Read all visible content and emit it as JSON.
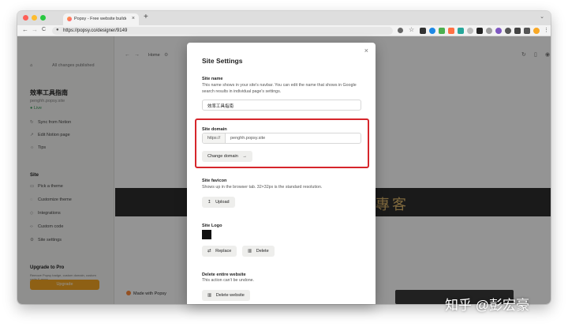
{
  "browser": {
    "tab_title": "Popsy - Free website builder f",
    "url": "https://popsy.co/designer/9149",
    "new_tab": "+",
    "tab_close": "×",
    "colors": {
      "close": "#fe5f57",
      "minimize": "#febc2e",
      "zoom": "#28c840"
    },
    "nav": {
      "back": "←",
      "forward": "→",
      "reload": "C"
    }
  },
  "app": {
    "saved_status": "All changes published",
    "site_title": "效率工具指南",
    "site_domain": "penghh.popsy.site",
    "live_badge": "● Live",
    "notion_items": [
      "Sync from Notion",
      "Edit Notion page",
      "Tips"
    ],
    "site_section": "Site",
    "site_items": [
      "Pick a theme",
      "Customize theme",
      "Integrations",
      "Custom code",
      "Site settings"
    ],
    "upgrade_title": "Upgrade to Pro",
    "upgrade_desc": "Remove Popsy badge, custom domain, custom code & more.",
    "upgrade_button": "Upgrade",
    "breadcrumb": "Home",
    "made_with": "Made with Popsy",
    "banner_text": "專客"
  },
  "modal": {
    "title": "Site Settings",
    "close": "×",
    "site_name": {
      "label": "Site name",
      "desc": "This name shows in your site's navbar. You can edit the name that shows in Google search results in individual page's settings.",
      "value": "效率工具指南"
    },
    "site_domain": {
      "label": "Site domain",
      "prefix": "https://",
      "value": "penghh.popsy.site",
      "button": "Change domain"
    },
    "site_favicon": {
      "label": "Site favicon",
      "desc": "Shows up in the browser tab. 32×32px is the standard resolution.",
      "button": "Upload"
    },
    "site_logo": {
      "label": "Site Logo",
      "replace": "Replace",
      "delete": "Delete"
    },
    "delete_site": {
      "label": "Delete entire website",
      "desc": "This action can't be undone.",
      "button": "Delete website"
    }
  },
  "watermark": "知乎 @彭宏豪",
  "highlight_color": "#d6262b"
}
